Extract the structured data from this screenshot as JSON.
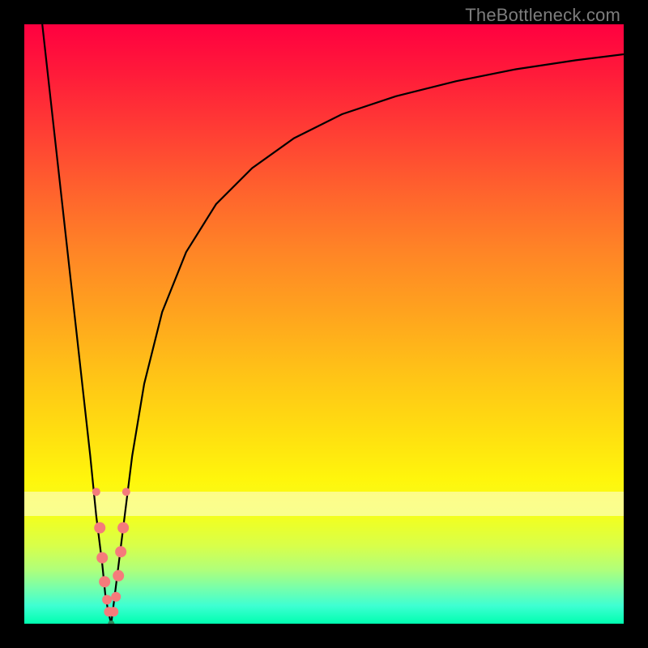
{
  "watermark": "TheBottleneck.com",
  "colors": {
    "frame": "#000000",
    "curve": "#000000",
    "marker_fill": "#f57b7b",
    "marker_stroke": "#e05858",
    "valley_marker": "#2a8a5c"
  },
  "chart_data": {
    "type": "line",
    "title": "",
    "xlabel": "",
    "ylabel": "",
    "xlim": [
      0,
      100
    ],
    "ylim": [
      0,
      100
    ],
    "grid": false,
    "white_band_y": [
      18,
      22
    ],
    "series": [
      {
        "name": "left-branch",
        "x": [
          3,
          5,
          7,
          9,
          11,
          12,
          13,
          13.5,
          14,
          14.5
        ],
        "y": [
          100,
          82,
          64,
          46,
          28,
          18,
          10,
          5,
          2,
          0
        ]
      },
      {
        "name": "right-branch",
        "x": [
          14.5,
          15,
          16,
          17,
          18,
          20,
          23,
          27,
          32,
          38,
          45,
          53,
          62,
          72,
          82,
          92,
          100
        ],
        "y": [
          0,
          4,
          12,
          20,
          28,
          40,
          52,
          62,
          70,
          76,
          81,
          85,
          88,
          90.5,
          92.5,
          94,
          95
        ]
      }
    ],
    "markers": {
      "name": "highlight-points",
      "color": "#f57b7b",
      "points": [
        {
          "x": 12.0,
          "y": 22,
          "r": 5
        },
        {
          "x": 12.6,
          "y": 16,
          "r": 7
        },
        {
          "x": 13.0,
          "y": 11,
          "r": 7
        },
        {
          "x": 13.4,
          "y": 7,
          "r": 7
        },
        {
          "x": 13.8,
          "y": 4,
          "r": 6
        },
        {
          "x": 14.1,
          "y": 2,
          "r": 6
        },
        {
          "x": 14.5,
          "y": 0,
          "r": 4,
          "color": "#2a8a5c"
        },
        {
          "x": 14.9,
          "y": 2,
          "r": 6
        },
        {
          "x": 15.3,
          "y": 4.5,
          "r": 6
        },
        {
          "x": 15.7,
          "y": 8,
          "r": 7
        },
        {
          "x": 16.1,
          "y": 12,
          "r": 7
        },
        {
          "x": 16.5,
          "y": 16,
          "r": 7
        },
        {
          "x": 17.0,
          "y": 22,
          "r": 5
        }
      ]
    }
  }
}
